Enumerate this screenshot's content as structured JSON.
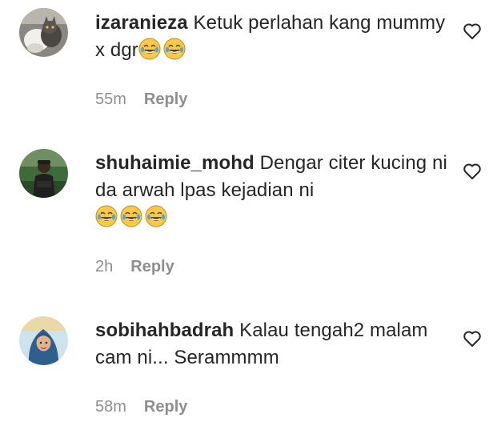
{
  "comments": [
    {
      "username": "izaranieza",
      "text": "Ketuk perlahan kang mummy x dgr",
      "emojis": [
        "joy-emoji",
        "joy-emoji"
      ],
      "time": "55m",
      "reply_label": "Reply",
      "avatar_icon": "cat-photo-avatar",
      "like_icon": "heart-outline-icon"
    },
    {
      "username": "shuhaimie_mohd",
      "text": "Dengar citer kucing ni da arwah lpas kejadian ni",
      "emojis": [
        "joy-emoji",
        "joy-emoji",
        "joy-emoji"
      ],
      "time": "2h",
      "reply_label": "Reply",
      "avatar_icon": "person-photo-avatar",
      "like_icon": "heart-outline-icon"
    },
    {
      "username": "sobihahbadrah",
      "text": "Kalau tengah2 malam cam ni... Serammmm",
      "emojis": [],
      "time": "58m",
      "reply_label": "Reply",
      "avatar_icon": "hijab-person-avatar",
      "like_icon": "heart-outline-icon"
    }
  ],
  "colors": {
    "text": "#262626",
    "meta": "#8e8e8e",
    "background": "#ffffff"
  }
}
